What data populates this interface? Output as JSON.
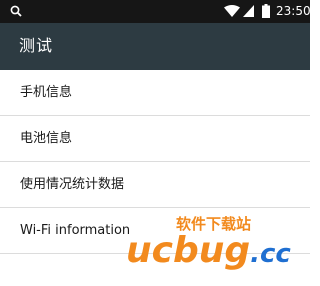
{
  "status_bar": {
    "time": "23:50",
    "icons": [
      "search-icon",
      "wifi-icon",
      "signal-icon",
      "battery-icon"
    ]
  },
  "app_bar": {
    "title": "测试"
  },
  "list": {
    "items": [
      {
        "label": "手机信息"
      },
      {
        "label": "电池信息"
      },
      {
        "label": "使用情况统计数据"
      },
      {
        "label": "Wi-Fi information"
      }
    ]
  },
  "watermark": {
    "text_top": "软件下载站",
    "text_main": "ucbug",
    "text_suffix": ".cc"
  },
  "colors": {
    "status_bar_bg": "#161616",
    "app_bar_bg": "#2d3b42",
    "divider": "#dcdcdc",
    "watermark_orange": "#f28a1e",
    "watermark_blue": "#1f6fd1"
  }
}
